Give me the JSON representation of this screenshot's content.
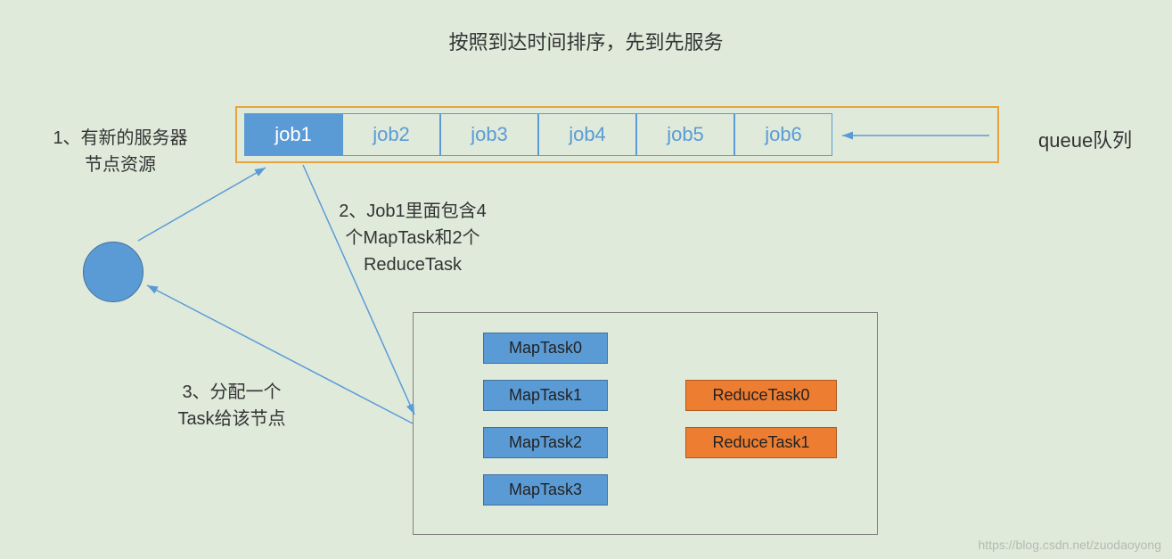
{
  "title": "按照到达时间排序，先到先服务",
  "queue_label": "queue队列",
  "jobs": [
    "job1",
    "job2",
    "job3",
    "job4",
    "job5",
    "job6"
  ],
  "note1_line1": "1、有新的服务器",
  "note1_line2": "节点资源",
  "note2_line1": "2、Job1里面包含4",
  "note2_line2": "个MapTask和2个",
  "note2_line3": "ReduceTask",
  "note3_line1": "3、分配一个",
  "note3_line2": "Task给该节点",
  "map_tasks": [
    "MapTask0",
    "MapTask1",
    "MapTask2",
    "MapTask3"
  ],
  "reduce_tasks": [
    "ReduceTask0",
    "ReduceTask1"
  ],
  "watermark": "https://blog.csdn.net/zuodaoyong",
  "colors": {
    "bg": "#dfeadb",
    "blue": "#5b9bd5",
    "orange_border": "#e8a33d",
    "orange_fill": "#ed7d31"
  }
}
